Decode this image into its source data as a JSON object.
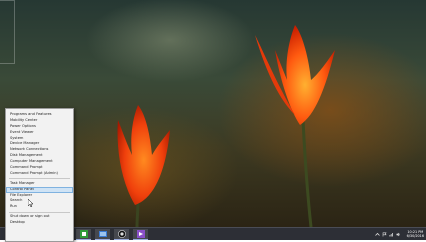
{
  "winx_menu": {
    "group1": [
      "Programs and Features",
      "Mobility Center",
      "Power Options",
      "Event Viewer",
      "System",
      "Device Manager",
      "Network Connections",
      "Disk Management",
      "Computer Management",
      "Command Prompt",
      "Command Prompt (Admin)"
    ],
    "group2": [
      "Task Manager",
      "Control Panel",
      "File Explorer",
      "Search",
      "Run"
    ],
    "group3": [
      "Shut down or sign out",
      "Desktop"
    ],
    "highlighted": "Control Panel"
  },
  "taskbar": {
    "apps": [
      {
        "name": "start",
        "icon": "windows-logo-icon"
      },
      {
        "name": "ie",
        "icon": "internet-explorer-icon"
      },
      {
        "name": "explorer",
        "icon": "file-explorer-icon"
      },
      {
        "name": "store",
        "icon": "store-icon"
      },
      {
        "name": "app",
        "icon": "settings-app-icon"
      },
      {
        "name": "obs",
        "icon": "record-app-icon"
      },
      {
        "name": "vs",
        "icon": "visual-studio-icon"
      }
    ],
    "clock_time": "10:21 PM",
    "clock_date": "6/30/2016"
  },
  "colors": {
    "taskbar": "#2d2f36",
    "menu_bg": "#f2f2f2",
    "highlight": "#cfe3f5"
  }
}
